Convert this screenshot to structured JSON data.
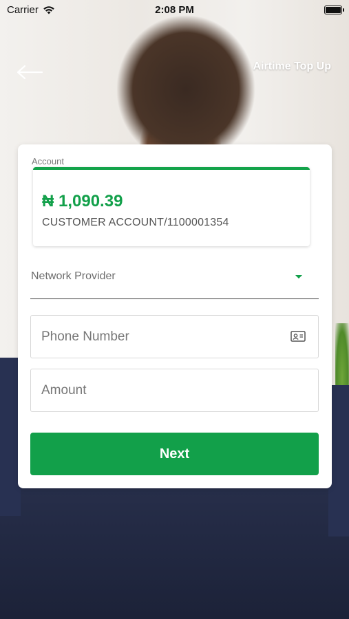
{
  "status_bar": {
    "carrier": "Carrier",
    "time": "2:08 PM"
  },
  "nav": {
    "back_icon": "arrow-left-icon",
    "title": "Airtime Top Up"
  },
  "account": {
    "label": "Account",
    "balance": "₦ 1,090.39",
    "name": "CUSTOMER ACCOUNT/1100001354"
  },
  "network_provider": {
    "label": "Network Provider",
    "icon": "caret-down-icon"
  },
  "phone": {
    "placeholder": "Phone Number",
    "icon": "contact-card-icon"
  },
  "amount": {
    "placeholder": "Amount"
  },
  "next_button": {
    "label": "Next"
  },
  "colors": {
    "accent": "#12a04a",
    "card_bg": "#ffffff"
  }
}
